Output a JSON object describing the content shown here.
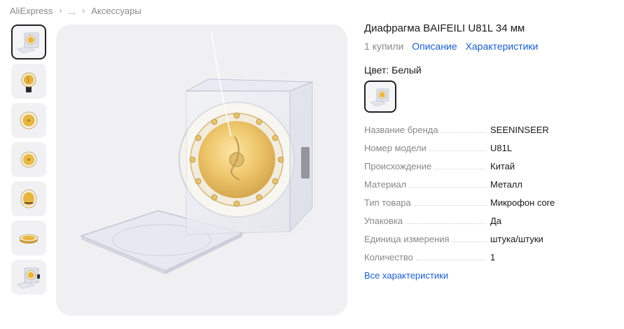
{
  "breadcrumb": {
    "home": "AliExpress",
    "ellipsis": "...",
    "category": "Аксессуары"
  },
  "product": {
    "title": "Диафрагма BAIFEILI U81L 34 мм",
    "sold": "1 купили",
    "description_link": "Описание",
    "characteristics_link": "Характеристики"
  },
  "color": {
    "label": "Цвет: Белый"
  },
  "specs": [
    {
      "name": "Название бренда",
      "value": "SEENINSEER"
    },
    {
      "name": "Номер модели",
      "value": "U81L"
    },
    {
      "name": "Происхождение",
      "value": "Китай"
    },
    {
      "name": "Материал",
      "value": "Металл"
    },
    {
      "name": "Тип товара",
      "value": "Микрофон core"
    },
    {
      "name": "Упаковка",
      "value": "Да"
    },
    {
      "name": "Единица измерения",
      "value": "штука/штуки"
    },
    {
      "name": "Количество",
      "value": "1"
    }
  ],
  "all_specs_link": "Все характеристики",
  "colors": {
    "link": "#1a5fc8",
    "muted": "#8a8a8a",
    "gold": "#e8b540",
    "image_bg": "#f0f0f2"
  },
  "icons": {
    "breadcrumb_separator": "chevron-right-icon"
  }
}
